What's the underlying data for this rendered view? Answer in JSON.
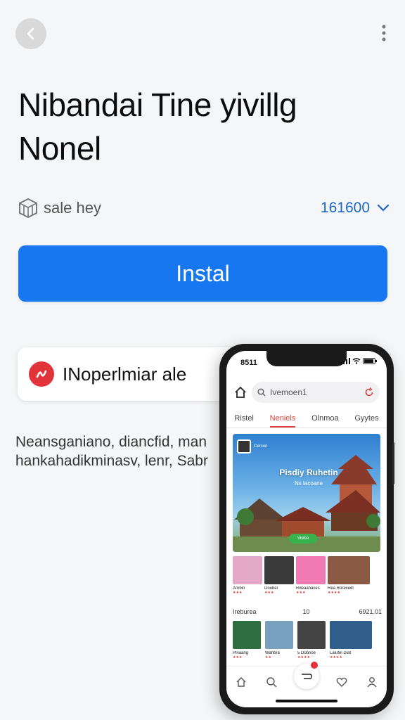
{
  "header": {
    "back_icon": "chevron-left-icon",
    "more_icon": "more-vertical-icon",
    "title": "Nibandai Tine yivillg Nonel"
  },
  "seller": {
    "icon": "cube-icon",
    "label": "sale hey"
  },
  "version": {
    "label": "161600",
    "icon": "chevron-down-icon"
  },
  "install": {
    "label": "Instal",
    "color": "#1677f0"
  },
  "chip": {
    "icon": "spark-icon",
    "label": "INoperlmiar ale",
    "icon_color": "#e0343a"
  },
  "description": "Neansganiano, diancfid, man hankahadikminasv, lenr, Sabr",
  "phone": {
    "status_time": "8511",
    "search_placeholder": "Ivemoen1",
    "tabs": [
      {
        "label": "Ristel",
        "active": false
      },
      {
        "label": "Neniels",
        "active": true
      },
      {
        "label": "Olnmoa",
        "active": false
      },
      {
        "label": "Gyytes",
        "active": false
      }
    ],
    "banner": {
      "small_text": "Cercon",
      "title": "Pisdiy Ruhetin",
      "subtitle": "Ns lacoane",
      "button": "Visibe"
    },
    "thumbs": [
      {
        "title": "Arnbin",
        "rating": "★★★",
        "color": "#e4a9c8"
      },
      {
        "title": "Doubel",
        "rating": "★★★",
        "color": "#3a3a3a"
      },
      {
        "title": "Rdeaahaces",
        "rating": "★★★",
        "color": "#f07ab2"
      },
      {
        "title": "Rea Rorecedl",
        "rating": "★★★★",
        "color": "#8a5a44"
      }
    ],
    "featured": {
      "label": "Ireburea",
      "count": "10",
      "right": "6921.01"
    },
    "featured_items": [
      {
        "title": "Plnaang",
        "rating": "★★★",
        "color": "#2e6d3f"
      },
      {
        "title": "Wanbra",
        "rating": "★★",
        "color": "#7aa0c0"
      },
      {
        "title": "5 Dobnoe",
        "rating": "★★★★",
        "color": "#444"
      },
      {
        "title": "Lalutel Diat",
        "rating": "★★★★",
        "color": "#315d8a"
      }
    ],
    "nav_icons": [
      "home-icon",
      "search-icon",
      "cart-icon",
      "heart-icon",
      "profile-icon"
    ]
  }
}
